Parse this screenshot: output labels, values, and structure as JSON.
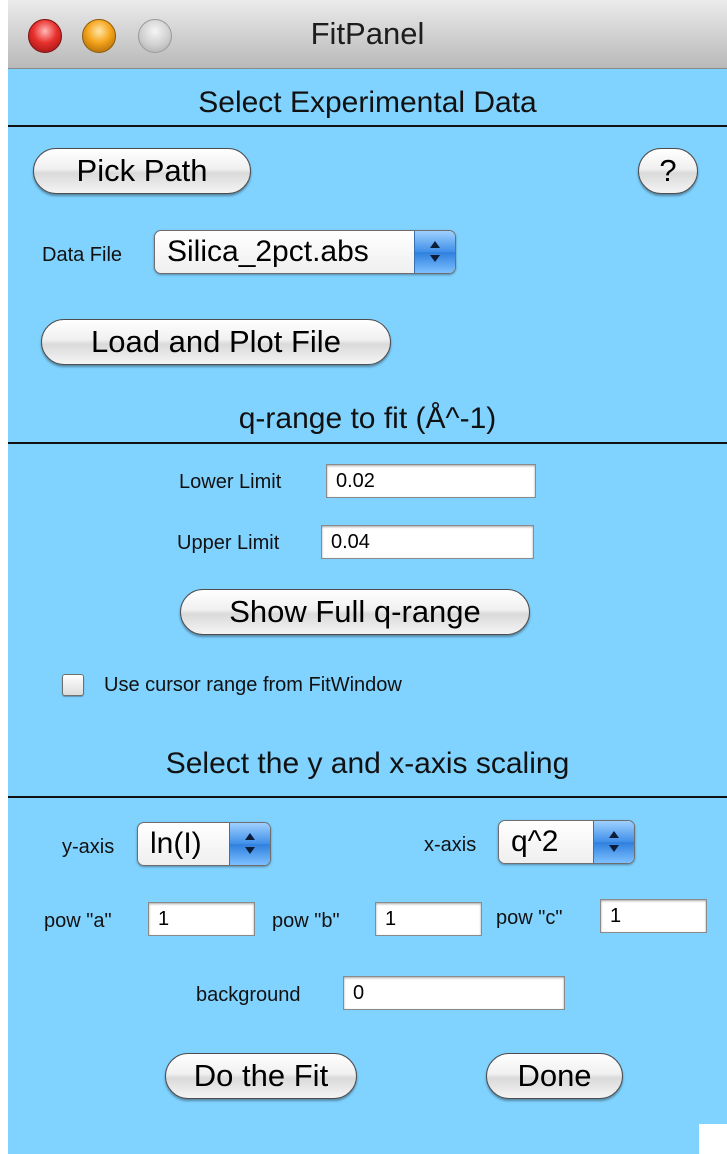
{
  "window": {
    "title": "FitPanel",
    "background_color": "#80d2ff"
  },
  "section_data": {
    "header": "Select Experimental Data",
    "pick_path_label": "Pick Path",
    "help_label": "?",
    "data_file_label": "Data File",
    "data_file_value": "Silica_2pct.abs",
    "load_plot_label": "Load and Plot File"
  },
  "section_qrange": {
    "header": "q-range to fit (Å^-1)",
    "lower_label": "Lower Limit",
    "lower_value": "0.02",
    "upper_label": "Upper Limit",
    "upper_value": "0.04",
    "full_range_label": "Show Full q-range",
    "cursor_checkbox_label": "Use cursor range from FitWindow",
    "cursor_checked": false
  },
  "section_scaling": {
    "header": "Select the y and x-axis scaling",
    "y_axis_label": "y-axis",
    "y_axis_value": "ln(I)",
    "x_axis_label": "x-axis",
    "x_axis_value": "q^2",
    "pow_a_label": "pow \"a\"",
    "pow_a_value": "1",
    "pow_b_label": "pow \"b\"",
    "pow_b_value": "1",
    "pow_c_label": "pow \"c\"",
    "pow_c_value": "1",
    "background_label": "background",
    "background_value": "0",
    "fit_label": "Do the Fit",
    "done_label": "Done"
  }
}
